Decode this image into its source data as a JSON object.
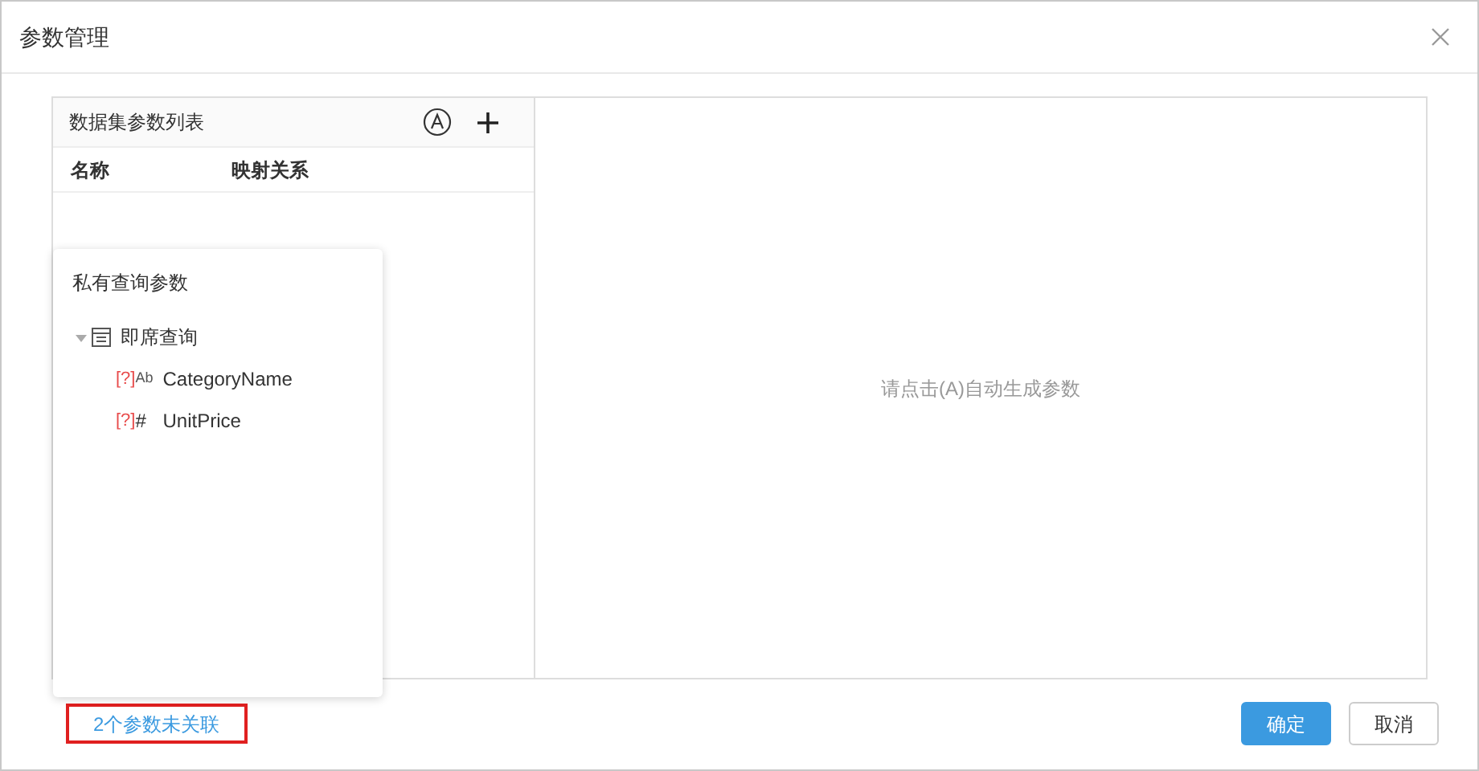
{
  "window": {
    "title": "参数管理"
  },
  "param_list": {
    "title": "数据集参数列表",
    "columns": [
      "名称",
      "映射关系"
    ]
  },
  "popup": {
    "title": "私有查询参数",
    "tree": [
      {
        "label": "即席查询",
        "expanded": true,
        "children": [
          {
            "label": "CategoryName",
            "mark": "[?]",
            "type_icon": "Ab"
          },
          {
            "label": "UnitPrice",
            "mark": "[?]",
            "type_icon": "#"
          }
        ]
      }
    ]
  },
  "detail": {
    "hint": "请点击(A)自动生成参数"
  },
  "footer": {
    "link": "2个参数未关联",
    "buttons": [
      {
        "label": "确定",
        "kind": "primary"
      },
      {
        "label": "取消",
        "kind": "default"
      }
    ]
  }
}
